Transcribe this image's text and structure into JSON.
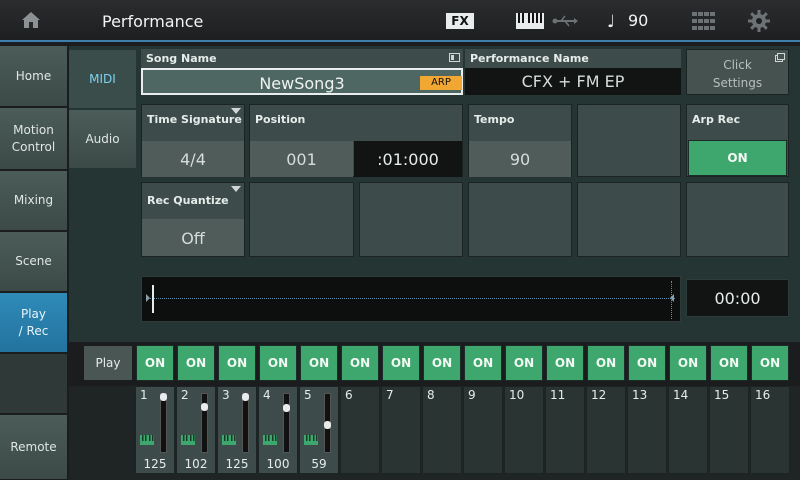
{
  "header": {
    "title": "Performance",
    "fx_label": "FX",
    "tempo": "90"
  },
  "nav": [
    {
      "label": "Home"
    },
    {
      "label": "Motion Control"
    },
    {
      "label": "Mixing"
    },
    {
      "label": "Scene"
    },
    {
      "label": "Play / Rec"
    },
    {
      "label": "Remote"
    }
  ],
  "subnav": [
    {
      "label": "MIDI"
    },
    {
      "label": "Audio"
    }
  ],
  "song": {
    "label": "Song Name",
    "value": "NewSong3",
    "badge": "ARP"
  },
  "performance": {
    "label": "Performance Name",
    "value": "CFX + FM EP"
  },
  "click_settings": {
    "line1": "Click",
    "line2": "Settings"
  },
  "time_signature": {
    "label": "Time Signature",
    "value": "4/4"
  },
  "position": {
    "label": "Position",
    "measure": "001",
    "beat": ":01:000"
  },
  "tempo": {
    "label": "Tempo",
    "value": "90"
  },
  "arp_rec": {
    "label": "Arp Rec",
    "state": "ON"
  },
  "rec_quantize": {
    "label": "Rec Quantize",
    "value": "Off"
  },
  "timeline": {
    "time": "00:00"
  },
  "play_row": {
    "label": "Play",
    "buttons": [
      "ON",
      "ON",
      "ON",
      "ON",
      "ON",
      "ON",
      "ON",
      "ON",
      "ON",
      "ON",
      "ON",
      "ON",
      "ON",
      "ON",
      "ON",
      "ON"
    ]
  },
  "tracks": [
    {
      "num": "1",
      "value": "125",
      "level": 1.0
    },
    {
      "num": "2",
      "value": "102",
      "level": 0.8
    },
    {
      "num": "3",
      "value": "125",
      "level": 1.0
    },
    {
      "num": "4",
      "value": "100",
      "level": 0.79
    },
    {
      "num": "5",
      "value": "59",
      "level": 0.46
    },
    {
      "num": "6"
    },
    {
      "num": "7"
    },
    {
      "num": "8"
    },
    {
      "num": "9"
    },
    {
      "num": "10"
    },
    {
      "num": "11"
    },
    {
      "num": "12"
    },
    {
      "num": "13"
    },
    {
      "num": "14"
    },
    {
      "num": "15"
    },
    {
      "num": "16"
    }
  ],
  "colors": {
    "accent_blue": "#2f8ab8",
    "on_green": "#3ea76d",
    "arp_orange": "#f0a833"
  }
}
